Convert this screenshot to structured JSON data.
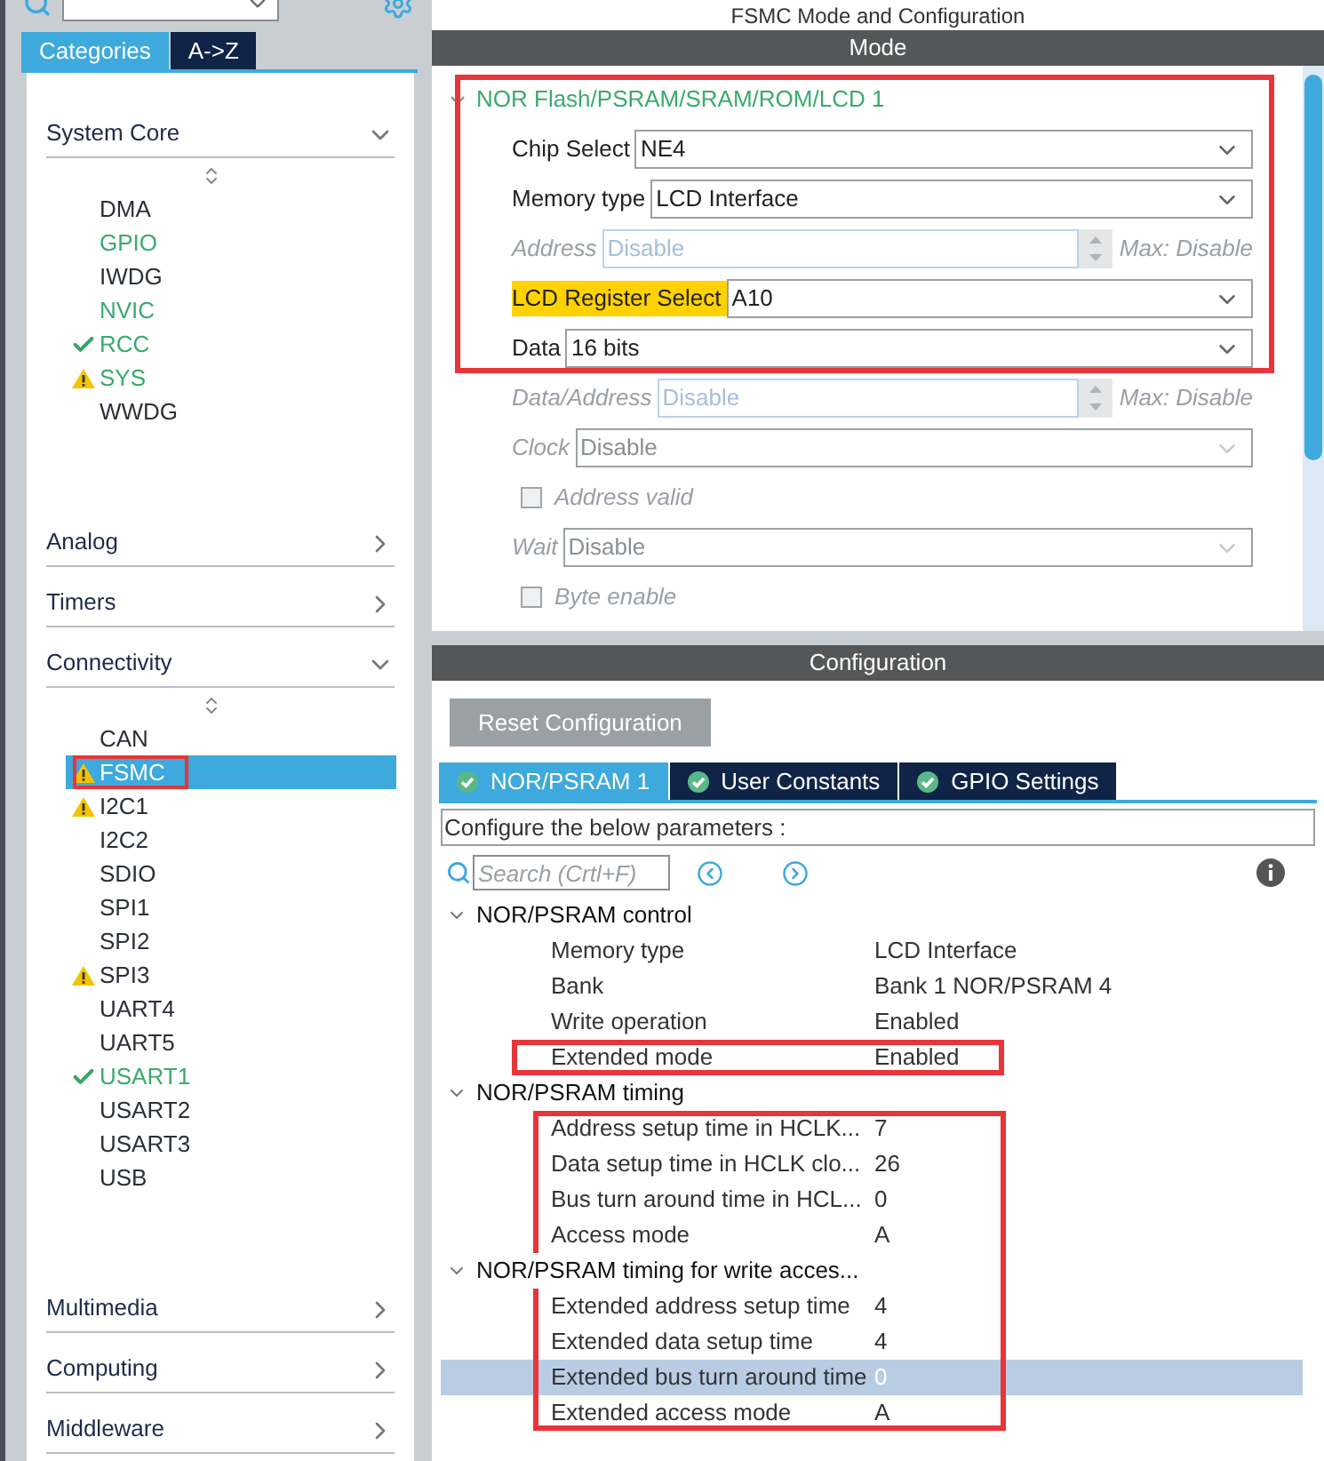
{
  "sidebar": {
    "tabs": [
      {
        "label": "Categories",
        "selected": true
      },
      {
        "label": "A->Z",
        "selected": false
      }
    ],
    "categories": [
      {
        "label": "System Core",
        "expanded": true,
        "items": [
          {
            "label": "DMA",
            "ok": false,
            "warning": false,
            "configured": false,
            "selected": false,
            "boxed": false
          },
          {
            "label": "GPIO",
            "ok": false,
            "warning": false,
            "configured": true,
            "selected": false,
            "boxed": false
          },
          {
            "label": "IWDG",
            "ok": false,
            "warning": false,
            "configured": false,
            "selected": false,
            "boxed": false
          },
          {
            "label": "NVIC",
            "ok": false,
            "warning": false,
            "configured": true,
            "selected": false,
            "boxed": false
          },
          {
            "label": "RCC",
            "ok": true,
            "warning": false,
            "configured": true,
            "selected": false,
            "boxed": false
          },
          {
            "label": "SYS",
            "ok": false,
            "warning": true,
            "configured": true,
            "selected": false,
            "boxed": false
          },
          {
            "label": "WWDG",
            "ok": false,
            "warning": false,
            "configured": false,
            "selected": false,
            "boxed": false
          }
        ]
      },
      {
        "label": "Analog",
        "expanded": false
      },
      {
        "label": "Timers",
        "expanded": false
      },
      {
        "label": "Connectivity",
        "expanded": true,
        "items": [
          {
            "label": "CAN",
            "ok": false,
            "warning": false,
            "configured": false,
            "selected": false,
            "boxed": false
          },
          {
            "label": "FSMC",
            "ok": false,
            "warning": true,
            "configured": false,
            "selected": true,
            "boxed": true
          },
          {
            "label": "I2C1",
            "ok": false,
            "warning": true,
            "configured": false,
            "selected": false,
            "boxed": false
          },
          {
            "label": "I2C2",
            "ok": false,
            "warning": false,
            "configured": false,
            "selected": false,
            "boxed": false
          },
          {
            "label": "SDIO",
            "ok": false,
            "warning": false,
            "configured": false,
            "selected": false,
            "boxed": false
          },
          {
            "label": "SPI1",
            "ok": false,
            "warning": false,
            "configured": false,
            "selected": false,
            "boxed": false
          },
          {
            "label": "SPI2",
            "ok": false,
            "warning": false,
            "configured": false,
            "selected": false,
            "boxed": false
          },
          {
            "label": "SPI3",
            "ok": false,
            "warning": true,
            "configured": false,
            "selected": false,
            "boxed": false
          },
          {
            "label": "UART4",
            "ok": false,
            "warning": false,
            "configured": false,
            "selected": false,
            "boxed": false
          },
          {
            "label": "UART5",
            "ok": false,
            "warning": false,
            "configured": false,
            "selected": false,
            "boxed": false
          },
          {
            "label": "USART1",
            "ok": true,
            "warning": false,
            "configured": true,
            "selected": false,
            "boxed": false
          },
          {
            "label": "USART2",
            "ok": false,
            "warning": false,
            "configured": false,
            "selected": false,
            "boxed": false
          },
          {
            "label": "USART3",
            "ok": false,
            "warning": false,
            "configured": false,
            "selected": false,
            "boxed": false
          },
          {
            "label": "USB",
            "ok": false,
            "warning": false,
            "configured": false,
            "selected": false,
            "boxed": false
          }
        ]
      },
      {
        "label": "Multimedia",
        "expanded": false
      },
      {
        "label": "Computing",
        "expanded": false
      },
      {
        "label": "Middleware",
        "expanded": false
      }
    ]
  },
  "title": "FSMC Mode and Configuration",
  "mode": {
    "header": "Mode",
    "group": {
      "label": "NOR Flash/PSRAM/SRAM/ROM/LCD 1",
      "expanded": true,
      "boxed": true
    },
    "fields": [
      {
        "kind": "select",
        "label": "Chip Select",
        "value": "NE4",
        "disabled": false,
        "highlighted": false,
        "boxed": true
      },
      {
        "kind": "select",
        "label": "Memory type",
        "value": "LCD Interface",
        "disabled": false,
        "highlighted": false,
        "boxed": true
      },
      {
        "kind": "spinner",
        "label": "Address",
        "value": "Disable",
        "max": "Max: Disable",
        "disabled": true,
        "boxed": true
      },
      {
        "kind": "select",
        "label": "LCD Register Select",
        "value": "A10",
        "disabled": false,
        "highlighted": true,
        "boxed": true
      },
      {
        "kind": "select",
        "label": "Data",
        "value": "16 bits",
        "disabled": false,
        "highlighted": false,
        "boxed": true
      },
      {
        "kind": "spinner",
        "label": "Data/Address",
        "value": "Disable",
        "max": "Max: Disable",
        "disabled": true,
        "boxed": false
      },
      {
        "kind": "select",
        "label": "Clock",
        "value": "Disable",
        "disabled": true,
        "highlighted": false,
        "boxed": false
      },
      {
        "kind": "checkbox",
        "label": "Address valid",
        "checked": false,
        "disabled": true,
        "boxed": false
      },
      {
        "kind": "select",
        "label": "Wait",
        "value": "Disable",
        "disabled": true,
        "highlighted": false,
        "boxed": false
      },
      {
        "kind": "checkbox",
        "label": "Byte enable",
        "checked": false,
        "disabled": true,
        "boxed": false
      }
    ]
  },
  "config": {
    "header": "Configuration",
    "reset_button": "Reset Configuration",
    "tabs": [
      {
        "label": "NOR/PSRAM 1",
        "selected": true
      },
      {
        "label": "User Constants",
        "selected": false
      },
      {
        "label": "GPIO Settings",
        "selected": false
      }
    ],
    "description": "Configure the below parameters :",
    "search": {
      "placeholder": "Search (Crtl+F)"
    },
    "rows": [
      {
        "kind": "group",
        "label": "NOR/PSRAM control",
        "expanded": true,
        "boxed": false
      },
      {
        "kind": "param",
        "label": "Memory type",
        "value": "LCD Interface",
        "selected": false,
        "boxed": false
      },
      {
        "kind": "param",
        "label": "Bank",
        "value": "Bank 1 NOR/PSRAM 4",
        "selected": false,
        "boxed": false
      },
      {
        "kind": "param",
        "label": "Write operation",
        "value": "Enabled",
        "selected": false,
        "boxed": false
      },
      {
        "kind": "param",
        "label": "Extended mode",
        "value": "Enabled",
        "selected": false,
        "boxed": true
      },
      {
        "kind": "group",
        "label": "NOR/PSRAM timing",
        "expanded": true,
        "boxed": false
      },
      {
        "kind": "param",
        "label": "Address setup time in HCLK...",
        "value": "7",
        "selected": false,
        "boxed": true
      },
      {
        "kind": "param",
        "label": "Data setup time in HCLK clo...",
        "value": "26",
        "selected": false,
        "boxed": true
      },
      {
        "kind": "param",
        "label": "Bus turn around time in HCL...",
        "value": "0",
        "selected": false,
        "boxed": true
      },
      {
        "kind": "param",
        "label": "Access mode",
        "value": "A",
        "selected": false,
        "boxed": true
      },
      {
        "kind": "group",
        "label": "NOR/PSRAM timing for write acces...",
        "expanded": true,
        "boxed": true
      },
      {
        "kind": "param",
        "label": "Extended address setup time",
        "value": "4",
        "selected": false,
        "boxed": true
      },
      {
        "kind": "param",
        "label": "Extended data setup time",
        "value": "4",
        "selected": false,
        "boxed": true
      },
      {
        "kind": "param",
        "label": "Extended bus turn around time",
        "value": "0",
        "selected": true,
        "boxed": true
      },
      {
        "kind": "param",
        "label": "Extended access mode",
        "value": "A",
        "selected": false,
        "boxed": true
      }
    ]
  }
}
